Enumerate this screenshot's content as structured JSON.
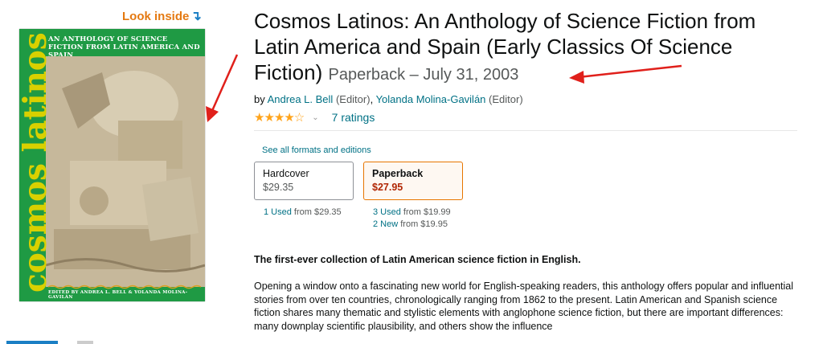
{
  "look_inside": {
    "label": "Look inside",
    "arrow_icon": "↴"
  },
  "cover": {
    "subtitle": "AN ANTHOLOGY OF SCIENCE FICTION FROM LATIN AMERICA AND SPAIN",
    "title": "cosmos latinos",
    "editors": "EDITED BY ANDREA L. BELL & YOLANDA MOLINA-GAVILÁN",
    "colors": {
      "background": "#1f9a44",
      "title": "#d9d000"
    }
  },
  "product": {
    "title": "Cosmos Latinos: An Anthology of Science Fiction from Latin America and Spain (Early Classics Of Science Fiction)",
    "format_date": "Paperback – July 31, 2003"
  },
  "byline": {
    "prefix": "by",
    "authors": [
      {
        "name": "Andrea L. Bell",
        "role": "(Editor)"
      },
      {
        "name": "Yolanda Molina-Gavilán",
        "role": "(Editor)"
      }
    ]
  },
  "rating": {
    "stars_value": 4.0,
    "stars_glyph": "★★★★☆",
    "chevron": "⌄",
    "count_label": "7 ratings"
  },
  "formats": {
    "see_all": "See all formats and editions",
    "options": [
      {
        "name": "Hardcover",
        "price": "$29.35",
        "selected": false
      },
      {
        "name": "Paperback",
        "price": "$27.95",
        "selected": true
      }
    ],
    "offers": {
      "hardcover": [
        {
          "link": "1 Used",
          "suffix": " from $29.35"
        }
      ],
      "paperback": [
        {
          "link": "3 Used",
          "suffix": " from $19.99"
        },
        {
          "link": "2 New",
          "suffix": " from $19.95"
        }
      ]
    }
  },
  "description": {
    "headline": "The first-ever collection of Latin American science fiction in English.",
    "body": "Opening a window onto a fascinating new world for English-speaking readers, this anthology offers popular and influential stories from over ten countries, chronologically ranging from 1862 to the present. Latin American and Spanish science fiction shares many thematic and stylistic elements with anglophone science fiction, but there are important differences: many downplay scientific plausibility, and others show the influence"
  },
  "accent_colors": {
    "link": "#007185",
    "price": "#b12704",
    "selected_border": "#e77600",
    "annotation_arrow": "#e0201b"
  }
}
